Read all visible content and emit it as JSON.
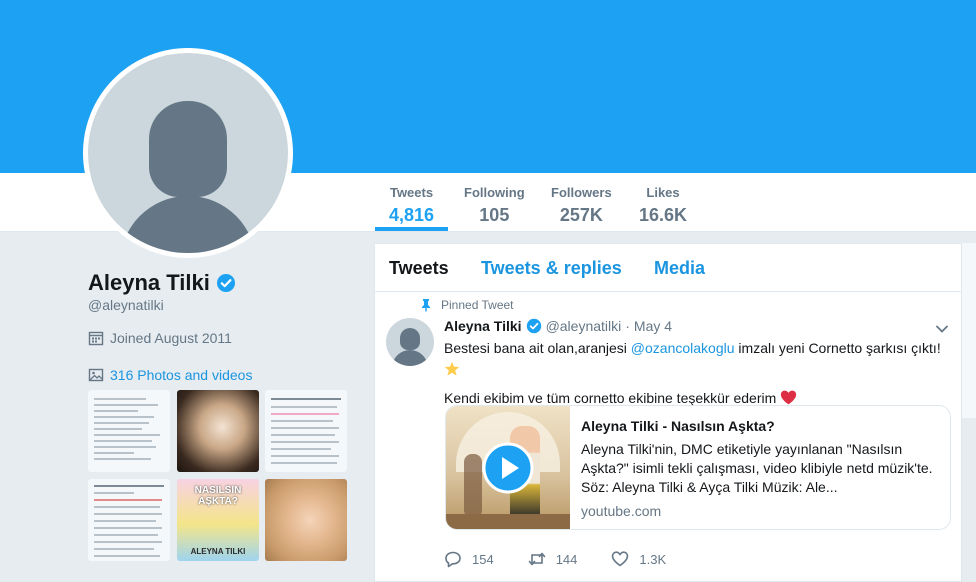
{
  "profile": {
    "name": "Aleyna Tilki",
    "handle": "@aleynatilki",
    "joined": "Joined August 2011",
    "photos_link": "316 Photos and videos"
  },
  "stats": [
    {
      "label": "Tweets",
      "value": "4,816"
    },
    {
      "label": "Following",
      "value": "105"
    },
    {
      "label": "Followers",
      "value": "257K"
    },
    {
      "label": "Likes",
      "value": "16.6K"
    }
  ],
  "tabs": [
    "Tweets",
    "Tweets & replies",
    "Media"
  ],
  "tweet": {
    "pinned_label": "Pinned Tweet",
    "author_name": "Aleyna Tilki",
    "author_handle": "@aleynatilki",
    "dot": "·",
    "date": "May 4",
    "text_part1": "Bestesi bana ait olan,aranjesi ",
    "mention": "@ozancolakoglu",
    "text_part2": " imzalı yeni Cornetto şarkısı çıktı!",
    "text_line2": "Kendi ekibim ve tüm cornetto ekibine teşekkür ederim",
    "card": {
      "title": "Aleyna Tilki - Nasılsın Aşkta?",
      "description": "Aleyna Tilki'nin, DMC etiketiyle yayınlanan \"Nasılsın Aşkta?\" isimli tekli çalışması, video klibiyle netd müzik'te. Söz: Aleyna Tilki & Ayça Tilki Müzik: Ale...",
      "domain": "youtube.com"
    },
    "replies": "154",
    "retweets": "144",
    "likes": "1.3K"
  },
  "thumbnails": {
    "album_text": "NASILSIN AŞKTA?",
    "album_artist": "ALEYNA TILKI"
  },
  "colors": {
    "brand_blue": "#1da1f2",
    "link_blue": "#1b95e0",
    "muted": "#657786",
    "heart": "#e0245e"
  }
}
